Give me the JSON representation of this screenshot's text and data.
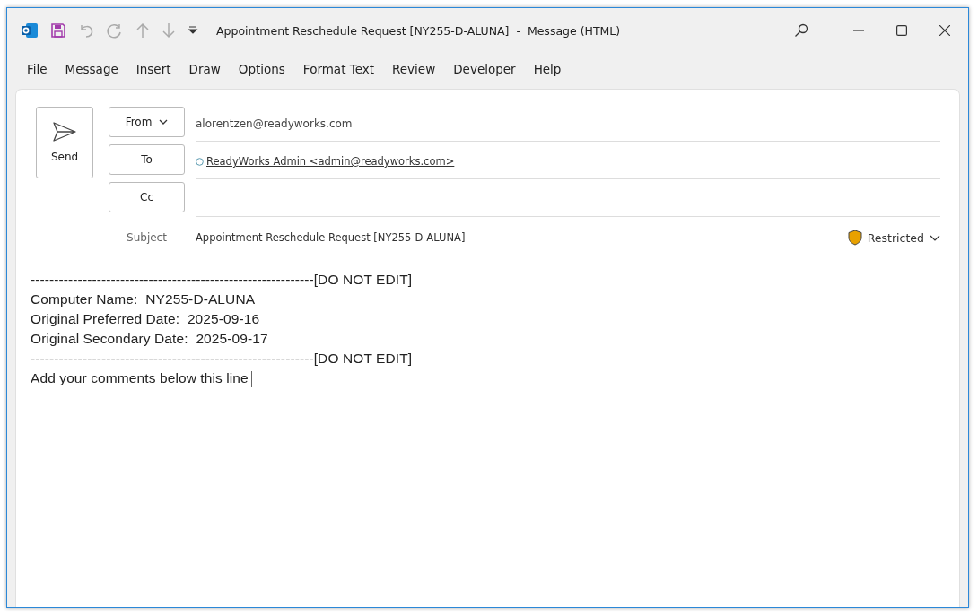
{
  "window": {
    "title": "Appointment Reschedule Request [NY255-D-ALUNA]  -  Message (HTML)"
  },
  "menu": [
    {
      "label": "File"
    },
    {
      "label": "Message"
    },
    {
      "label": "Insert"
    },
    {
      "label": "Draw"
    },
    {
      "label": "Options"
    },
    {
      "label": "Format Text"
    },
    {
      "label": "Review"
    },
    {
      "label": "Developer"
    },
    {
      "label": "Help"
    }
  ],
  "compose": {
    "send_button": "Send",
    "from_button": "From",
    "from_value": "alorentzen@readyworks.com",
    "to_button": "To",
    "to_recipients": [
      "ReadyWorks Admin <admin@readyworks.com>"
    ],
    "cc_button": "Cc",
    "subject_label": "Subject",
    "subject_value": "Appointment Reschedule Request [NY255-D-ALUNA]",
    "sensitivity": "Restricted"
  },
  "body": {
    "lines": [
      "------------------------------------------------------------[DO NOT EDIT]",
      "Computer Name:  NY255-D-ALUNA",
      "Original Preferred Date:  2025-09-16",
      "Original Secondary Date:  2025-09-17",
      "------------------------------------------------------------[DO NOT EDIT]",
      "Add your comments below this line"
    ]
  }
}
